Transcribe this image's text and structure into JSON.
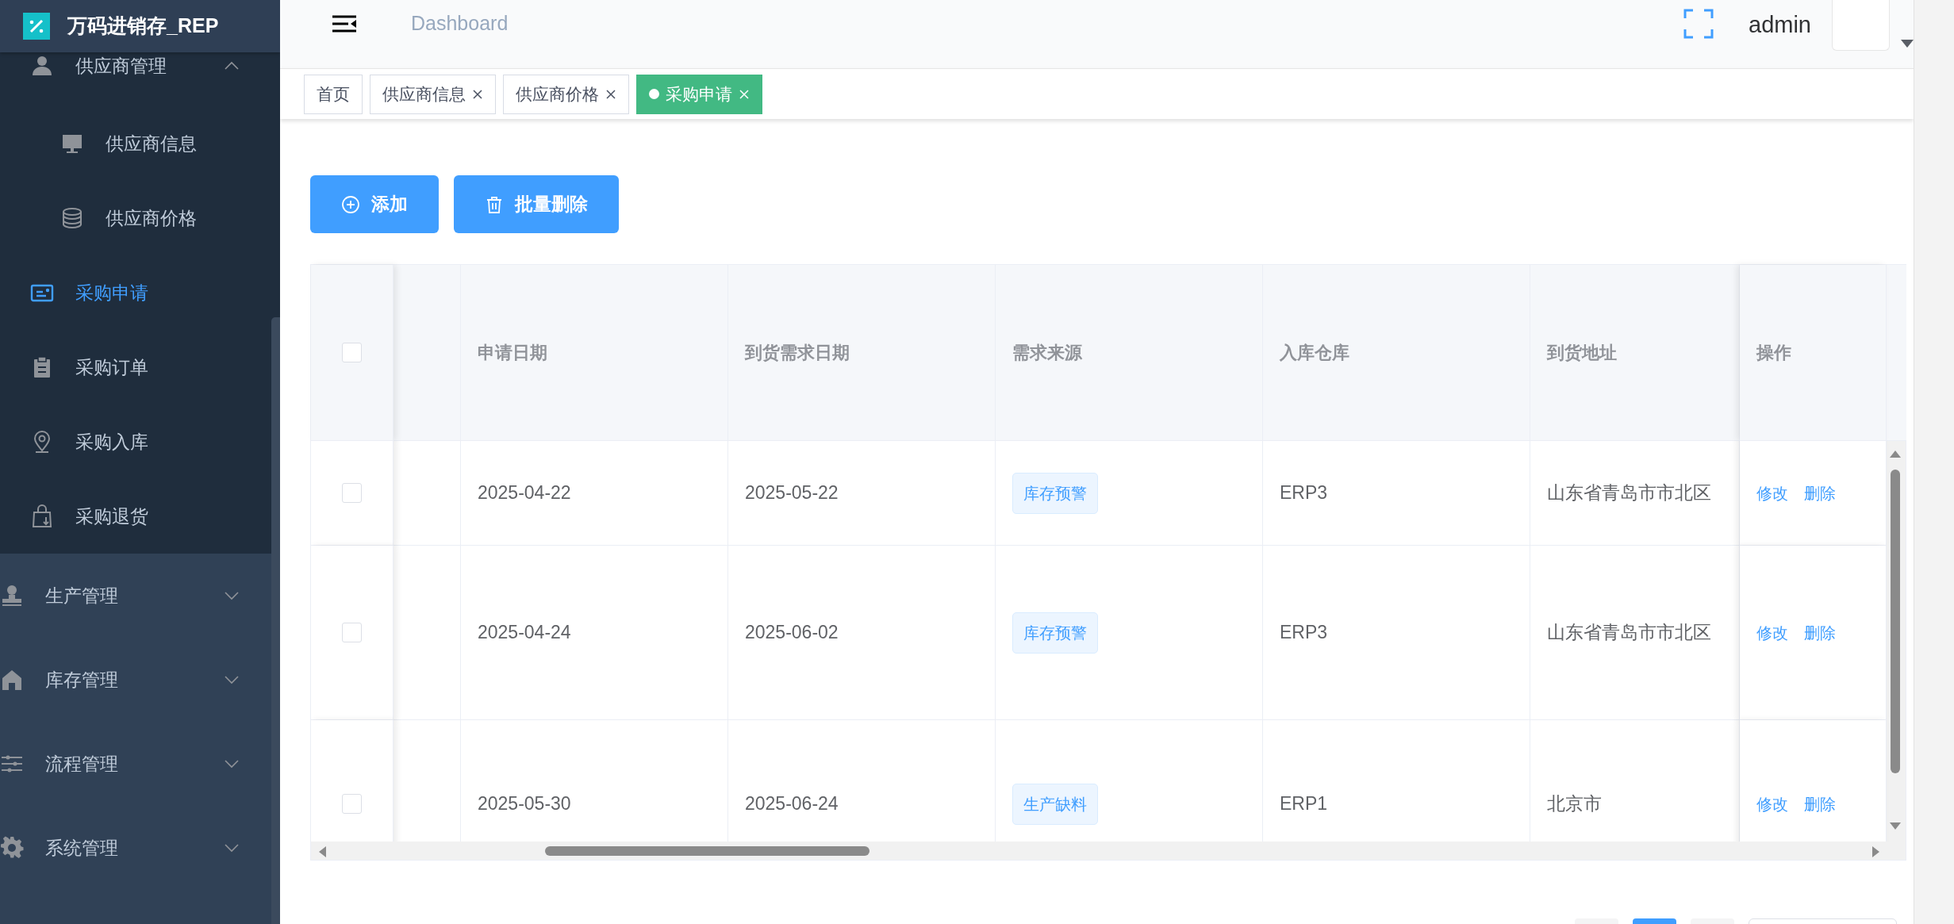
{
  "sidebar": {
    "logo_text": "万码进销存_REP",
    "submenu_items": [
      {
        "label": "供应商管理",
        "selected": false,
        "expanded": true,
        "children": [
          {
            "label": "供应商信息",
            "selected": false
          },
          {
            "label": "供应商价格",
            "selected": false
          }
        ]
      },
      {
        "label": "采购申请",
        "selected": true
      },
      {
        "label": "采购订单",
        "selected": false
      },
      {
        "label": "采购入库",
        "selected": false
      },
      {
        "label": "采购退货",
        "selected": false
      }
    ],
    "menu_groups": [
      {
        "label": "生产管理",
        "expanded": false
      },
      {
        "label": "库存管理",
        "expanded": false
      },
      {
        "label": "流程管理",
        "expanded": false
      },
      {
        "label": "系统管理",
        "expanded": false
      }
    ]
  },
  "header": {
    "breadcrumb": "Dashboard",
    "username": "admin"
  },
  "tags": [
    {
      "label": "首页",
      "selected": false,
      "closable": false
    },
    {
      "label": "供应商信息",
      "selected": false,
      "closable": true
    },
    {
      "label": "供应商价格",
      "selected": false,
      "closable": true
    },
    {
      "label": "采购申请",
      "selected": true,
      "closable": true
    }
  ],
  "toolbar": {
    "buttons": [
      {
        "label": "添加",
        "kind": "add"
      },
      {
        "label": "批量删除",
        "kind": "delete"
      }
    ]
  },
  "table": {
    "header_checked": false,
    "columns": [
      "申请日期",
      "到货需求日期",
      "需求来源",
      "入库仓库",
      "到货地址",
      "操作"
    ],
    "rows": [
      {
        "checked": false,
        "apply_date": "2025-04-22",
        "required_date": "2025-05-22",
        "source": "库存预警",
        "warehouse": "ERP3",
        "address": "山东省青岛市市北区",
        "actions": [
          "修改",
          "删除"
        ]
      },
      {
        "checked": false,
        "apply_date": "2025-04-24",
        "required_date": "2025-06-02",
        "source": "库存预警",
        "warehouse": "ERP3",
        "address": "山东省青岛市市北区",
        "actions": [
          "修改",
          "删除"
        ]
      },
      {
        "checked": false,
        "apply_date": "2025-05-30",
        "required_date": "2025-06-24",
        "source": "生产缺料",
        "warehouse": "ERP1",
        "address": "北京市",
        "actions": [
          "修改",
          "删除"
        ]
      }
    ]
  },
  "pagination": {
    "pages": [
      {
        "selected": false
      },
      {
        "selected": true
      },
      {
        "selected": false
      }
    ]
  }
}
